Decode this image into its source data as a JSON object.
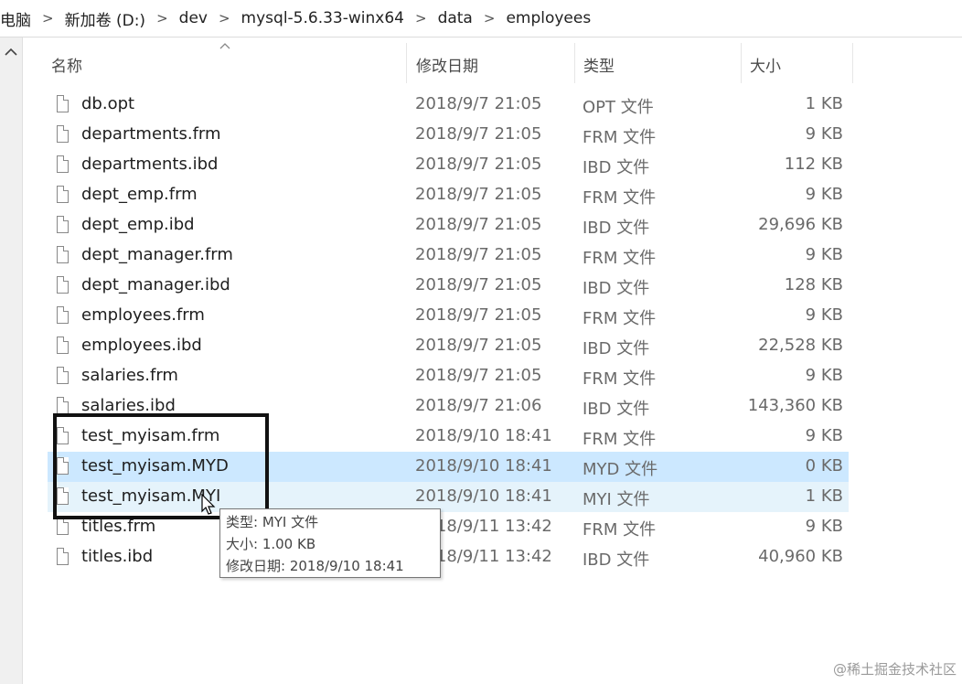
{
  "breadcrumb": {
    "items": [
      "电脑",
      "新加卷 (D:)",
      "dev",
      "mysql-5.6.33-winx64",
      "data",
      "employees"
    ]
  },
  "columns": {
    "name": "名称",
    "date": "修改日期",
    "type": "类型",
    "size": "大小"
  },
  "files": [
    {
      "name": "db.opt",
      "date": "2018/9/7 21:05",
      "type": "OPT 文件",
      "size": "1 KB"
    },
    {
      "name": "departments.frm",
      "date": "2018/9/7 21:05",
      "type": "FRM 文件",
      "size": "9 KB"
    },
    {
      "name": "departments.ibd",
      "date": "2018/9/7 21:05",
      "type": "IBD 文件",
      "size": "112 KB"
    },
    {
      "name": "dept_emp.frm",
      "date": "2018/9/7 21:05",
      "type": "FRM 文件",
      "size": "9 KB"
    },
    {
      "name": "dept_emp.ibd",
      "date": "2018/9/7 21:05",
      "type": "IBD 文件",
      "size": "29,696 KB"
    },
    {
      "name": "dept_manager.frm",
      "date": "2018/9/7 21:05",
      "type": "FRM 文件",
      "size": "9 KB"
    },
    {
      "name": "dept_manager.ibd",
      "date": "2018/9/7 21:05",
      "type": "IBD 文件",
      "size": "128 KB"
    },
    {
      "name": "employees.frm",
      "date": "2018/9/7 21:05",
      "type": "FRM 文件",
      "size": "9 KB"
    },
    {
      "name": "employees.ibd",
      "date": "2018/9/7 21:05",
      "type": "IBD 文件",
      "size": "22,528 KB"
    },
    {
      "name": "salaries.frm",
      "date": "2018/9/7 21:05",
      "type": "FRM 文件",
      "size": "9 KB"
    },
    {
      "name": "salaries.ibd",
      "date": "2018/9/7 21:06",
      "type": "IBD 文件",
      "size": "143,360 KB"
    },
    {
      "name": "test_myisam.frm",
      "date": "2018/9/10 18:41",
      "type": "FRM 文件",
      "size": "9 KB"
    },
    {
      "name": "test_myisam.MYD",
      "date": "2018/9/10 18:41",
      "type": "MYD 文件",
      "size": "0 KB"
    },
    {
      "name": "test_myisam.MYI",
      "date": "2018/9/10 18:41",
      "type": "MYI 文件",
      "size": "1 KB"
    },
    {
      "name": "titles.frm",
      "date": "2018/9/11 13:42",
      "type": "FRM 文件",
      "size": "9 KB"
    },
    {
      "name": "titles.ibd",
      "date": "2018/9/11 13:42",
      "type": "IBD 文件",
      "size": "40,960 KB"
    }
  ],
  "tooltip": {
    "line1": "类型: MYI 文件",
    "line2": "大小: 1.00 KB",
    "line3": "修改日期: 2018/9/10 18:41"
  },
  "watermark": "@稀土掘金技术社区",
  "colors": {
    "selected_row": "#cce8ff",
    "hover_row": "#e5f3fb",
    "annotation_box": "#111111"
  },
  "icons": {
    "file": "file-icon",
    "nav_up": "chevron-up-icon",
    "breadcrumb_sep": "chevron-right-icon",
    "sort": "sort-caret-icon"
  }
}
